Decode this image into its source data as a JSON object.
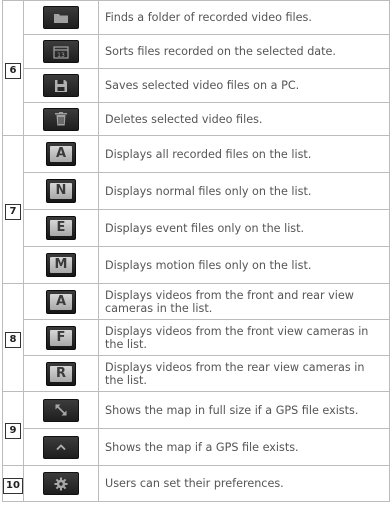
{
  "groups": [
    {
      "number": "6",
      "rows": [
        {
          "icon": "folder-icon",
          "text": "Finds a folder of recorded video files."
        },
        {
          "icon": "calendar-icon",
          "icon_text": "13",
          "text": "Sorts files recorded on the selected date."
        },
        {
          "icon": "save-icon",
          "text": "Saves selected video files on a PC."
        },
        {
          "icon": "trash-icon",
          "text": "Deletes selected video files."
        }
      ]
    },
    {
      "number": "7",
      "rows": [
        {
          "icon": "letter-a-icon",
          "letter": "A",
          "text": "Displays all recorded files on the list."
        },
        {
          "icon": "letter-n-icon",
          "letter": "N",
          "text": "Displays normal files only on the list."
        },
        {
          "icon": "letter-e-icon",
          "letter": "E",
          "text": "Displays event files only on the list."
        },
        {
          "icon": "letter-m-icon",
          "letter": "M",
          "text": "Displays motion files only on the list."
        }
      ]
    },
    {
      "number": "8",
      "rows": [
        {
          "icon": "letter-a-icon",
          "letter": "A",
          "text": "Displays videos from the front and rear view cameras in the list."
        },
        {
          "icon": "letter-f-icon",
          "letter": "F",
          "text": "Displays videos from the front view cameras in the list."
        },
        {
          "icon": "letter-r-icon",
          "letter": "R",
          "text": "Displays videos from the rear view cameras in the list."
        }
      ]
    },
    {
      "number": "9",
      "rows": [
        {
          "icon": "expand-arrow-icon",
          "text": "Shows the map in full size if a GPS file exists."
        },
        {
          "icon": "chevron-up-icon",
          "text": "Shows the map if a GPS file exists."
        }
      ]
    },
    {
      "number": "10",
      "rows": [
        {
          "icon": "gear-icon",
          "text": "Users can set their preferences."
        }
      ]
    }
  ]
}
